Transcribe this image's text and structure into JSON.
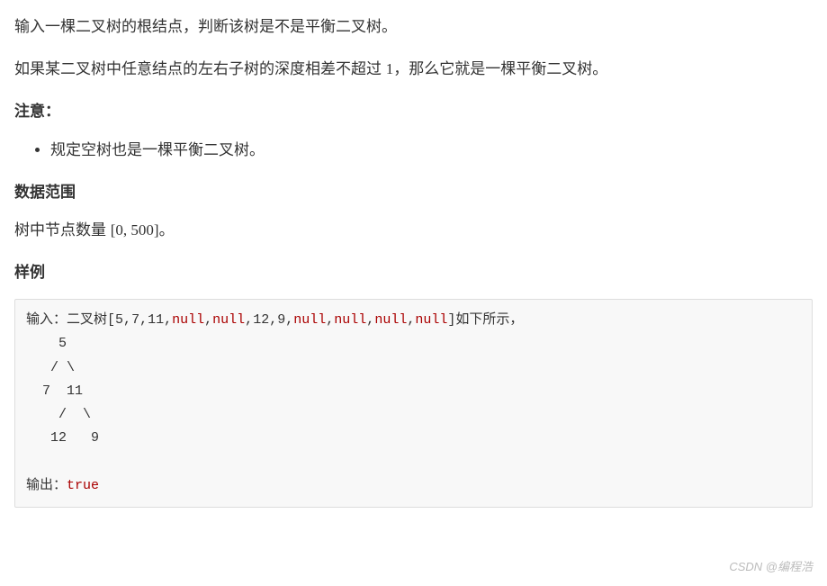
{
  "para1": "输入一棵二叉树的根结点，判断该树是不是平衡二叉树。",
  "para2_a": "如果某二叉树中任意结点的左右子树的深度相差不超过 ",
  "para2_num": "1",
  "para2_b": "，那么它就是一棵平衡二叉树。",
  "notice_heading": "注意：",
  "bullet1": "规定空树也是一棵平衡二叉树。",
  "range_heading": "数据范围",
  "range_text_a": "树中节点数量 ",
  "range_value": "[0, 500]",
  "range_text_b": "。",
  "sample_heading": "样例",
  "code": {
    "input_label": "输入：二叉树",
    "array_open": "[",
    "v1": "5",
    "v2": "7",
    "v3": "11",
    "n1": "null",
    "n2": "null",
    "v4": "12",
    "v5": "9",
    "n3": "null",
    "n4": "null",
    "n5": "null",
    "n6": "null",
    "array_close": "]",
    "after_array": "如下所示，",
    "comma": ",",
    "tree_l1": "    5",
    "tree_l2": "   / \\",
    "tree_l3": "  7  11",
    "tree_l4": "    /  \\",
    "tree_l5": "   12   9",
    "output_label": "输出：",
    "output_value": "true"
  },
  "watermark": "CSDN @编程浩"
}
